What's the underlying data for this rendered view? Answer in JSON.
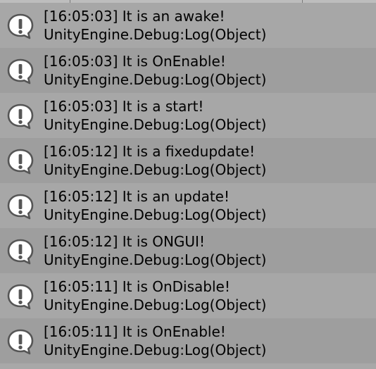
{
  "console": {
    "entries": [
      {
        "message": "[16:05:03] It is an awake!",
        "source": "UnityEngine.Debug:Log(Object)",
        "icon": "info-speech-bubble-icon"
      },
      {
        "message": "[16:05:03] It is OnEnable!",
        "source": "UnityEngine.Debug:Log(Object)",
        "icon": "info-speech-bubble-icon"
      },
      {
        "message": "[16:05:03] It is a start!",
        "source": "UnityEngine.Debug:Log(Object)",
        "icon": "info-speech-bubble-icon"
      },
      {
        "message": "[16:05:12] It is a fixedupdate!",
        "source": "UnityEngine.Debug:Log(Object)",
        "icon": "info-speech-bubble-icon"
      },
      {
        "message": "[16:05:12] It is an update!",
        "source": "UnityEngine.Debug:Log(Object)",
        "icon": "info-speech-bubble-icon"
      },
      {
        "message": "[16:05:12] It is ONGUI!",
        "source": "UnityEngine.Debug:Log(Object)",
        "icon": "info-speech-bubble-icon"
      },
      {
        "message": "[16:05:11] It is OnDisable!",
        "source": "UnityEngine.Debug:Log(Object)",
        "icon": "info-speech-bubble-icon"
      },
      {
        "message": "[16:05:11] It is OnEnable!",
        "source": "UnityEngine.Debug:Log(Object)",
        "icon": "info-speech-bubble-icon"
      }
    ]
  },
  "colors": {
    "row_light": "#a7a7a7",
    "row_dark": "#9e9e9e",
    "icon_fill": "#ffffff",
    "icon_stroke": "#555555",
    "text": "#000000"
  }
}
